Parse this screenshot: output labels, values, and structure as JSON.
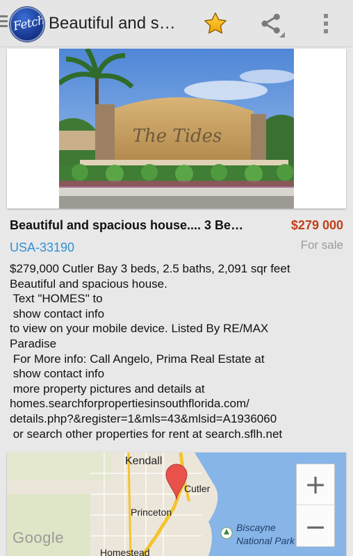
{
  "app": {
    "logo_text": "Fetch",
    "title": "Beautiful and s…",
    "icons": {
      "drawer": "drawer-indicator-icon",
      "favorite": "star-icon",
      "share": "share-icon",
      "overflow": "overflow-menu-icon"
    }
  },
  "listing": {
    "title": "Beautiful and spacious house.... 3 Be…",
    "price": "$279 000",
    "id": "USA-33190",
    "status": "For sale",
    "photo_sign_text": "The Tides"
  },
  "description": {
    "lines": [
      "$279,000 Cutler Bay 3 beds, 2.5 baths, 2,091 sqr feet",
      "Beautiful and spacious house.",
      " Text \"HOMES\" to",
      " show contact info",
      "to view on your mobile device. Listed By RE/MAX",
      "Paradise",
      " For More info: Call Angelo, Prima Real Estate at",
      " show contact info",
      " more property pictures and details at",
      "homes.searchforpropertiesinsouthflorida.com/",
      "details.php?&register=1&mls=43&mlsid=A1936060",
      " or search other properties for rent at search.sflh.net"
    ]
  },
  "map": {
    "labels": {
      "kendall": "Kendall",
      "cutler": "Cutler",
      "princeton": "Princeton",
      "biscayne_1": "Biscayne",
      "biscayne_2": "National Park",
      "homestead": "Homestead"
    },
    "zoom_in": "+",
    "zoom_out": "−",
    "attribution": "Google",
    "colors": {
      "water": "#88b5e8",
      "land": "#ece6da",
      "road": "#f4c430",
      "pin": "#e8524b"
    }
  }
}
